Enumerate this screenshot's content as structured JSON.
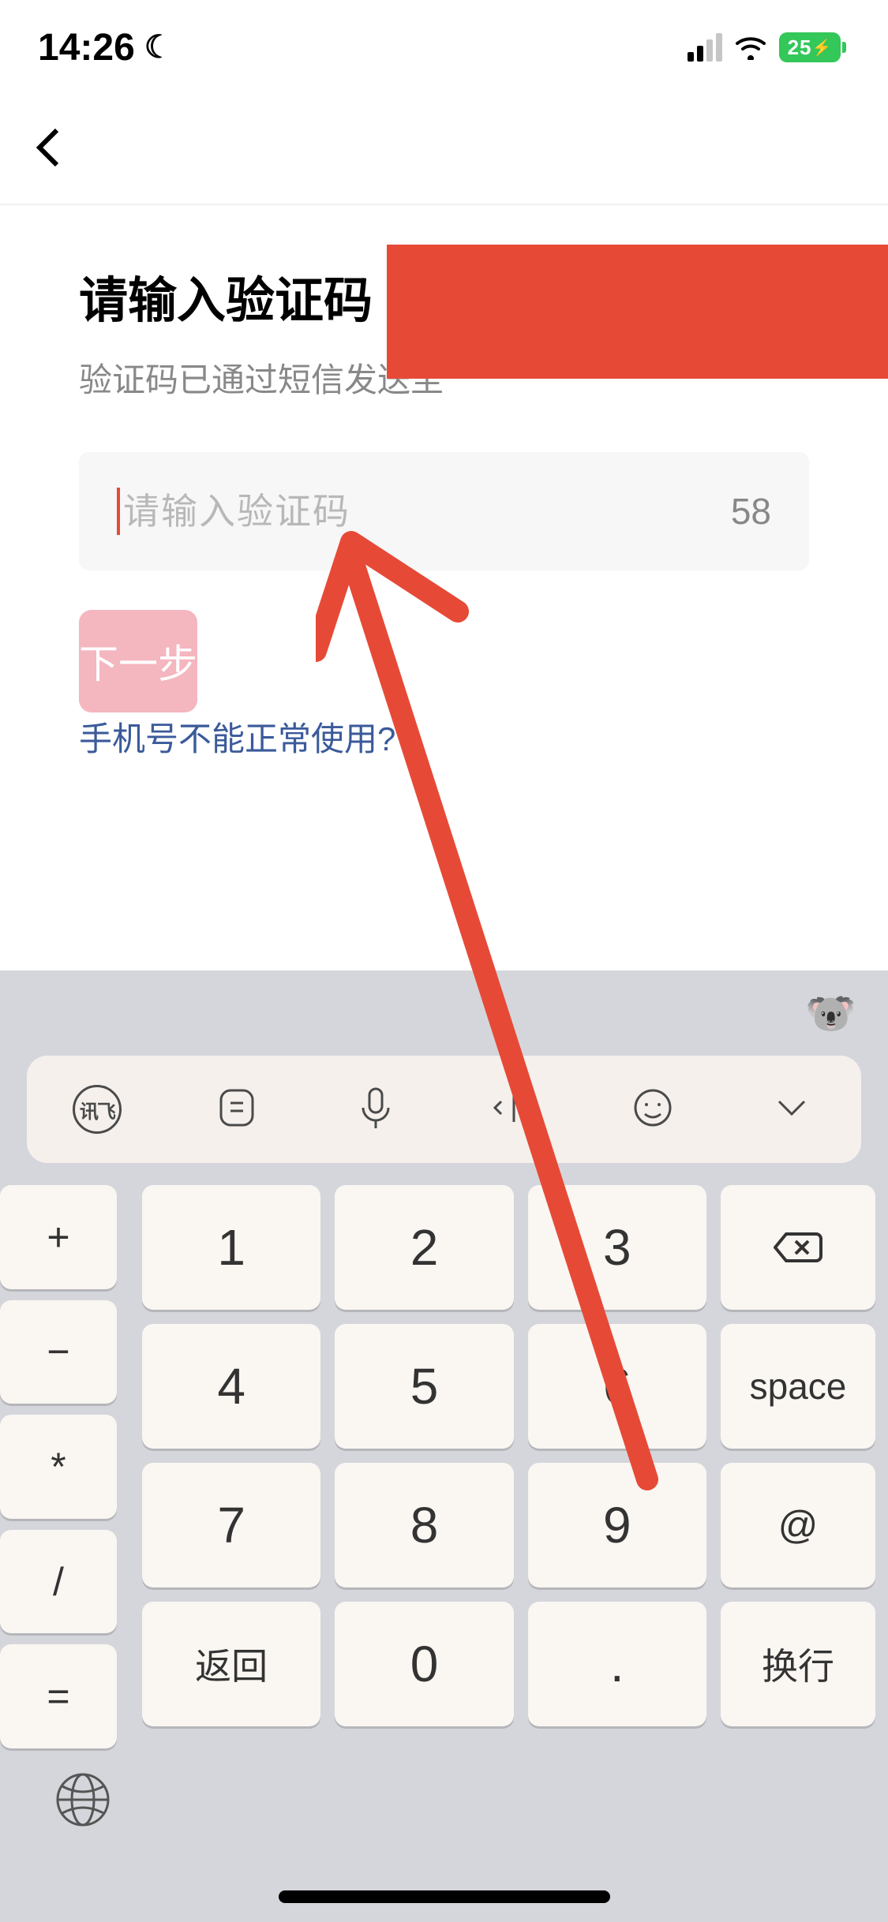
{
  "status": {
    "time": "14:26",
    "battery_pct": "25",
    "dnd": true
  },
  "page": {
    "title": "请输入验证码",
    "subtitle": "验证码已通过短信发送至",
    "input_placeholder": "请输入验证码",
    "countdown": "58",
    "next_button": "下一步",
    "help_link": "手机号不能正常使用?"
  },
  "keyboard": {
    "symbols": [
      "+",
      "−",
      "*",
      "/",
      "="
    ],
    "digits": {
      "r1": [
        "1",
        "2",
        "3"
      ],
      "r2": [
        "4",
        "5",
        "6"
      ],
      "r3": [
        "7",
        "8",
        "9"
      ],
      "r4": [
        "返回",
        "0",
        "."
      ]
    },
    "right": {
      "backspace_label": "⌫",
      "space": "space",
      "at": "@",
      "enter": "换行"
    },
    "toolbar_badge": "讯飞"
  }
}
